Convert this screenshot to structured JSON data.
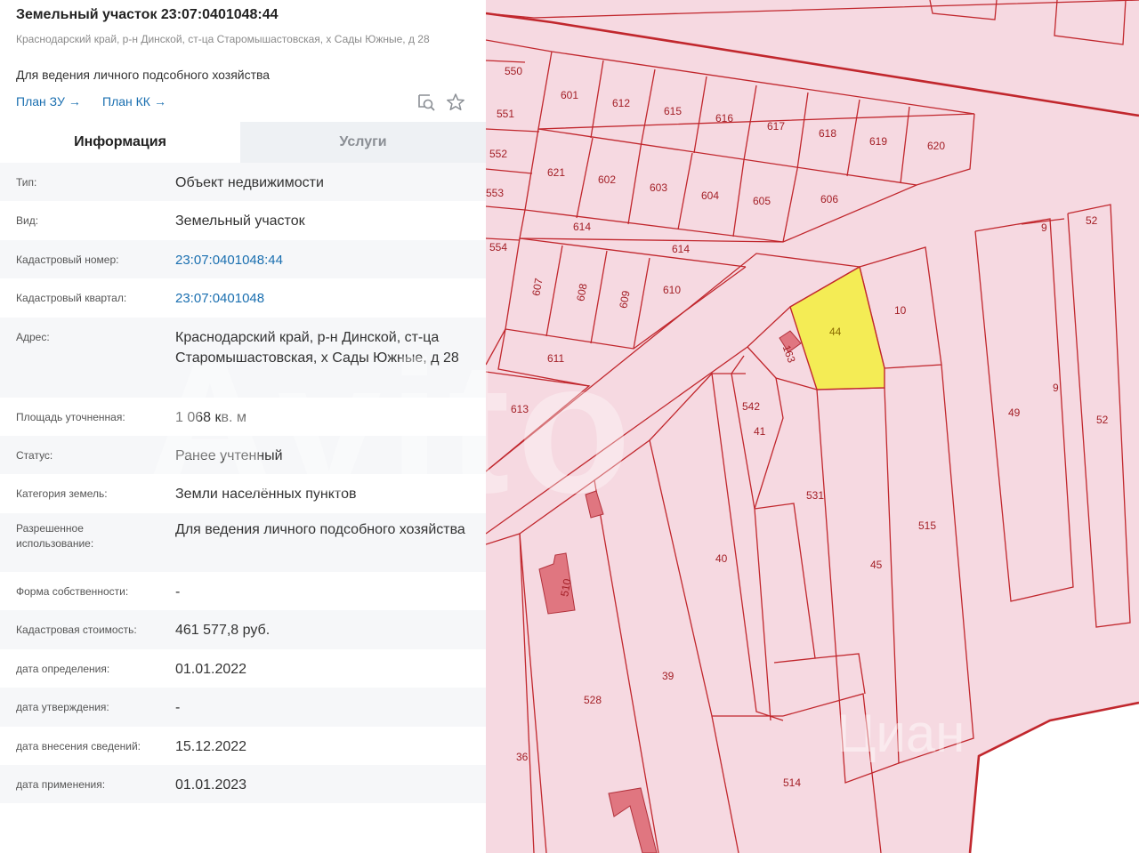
{
  "header": {
    "title": "Земельный участок 23:07:0401048:44",
    "address": "Краснодарский край, р-н Динской, ст-ца Старомышастовская, х Сады Южные, д 28",
    "purpose": "Для ведения личного подсобного хозяйства",
    "links": [
      {
        "label": "План ЗУ"
      },
      {
        "label": "План КК"
      }
    ],
    "arrow": "→"
  },
  "tabs": [
    {
      "label": "Информация",
      "active": true
    },
    {
      "label": "Услуги",
      "active": false
    }
  ],
  "info": [
    {
      "label": "Тип:",
      "value": "Объект недвижимости"
    },
    {
      "label": "Вид:",
      "value": "Земельный участок"
    },
    {
      "label": "Кадастровый номер:",
      "value": "23:07:0401048:44",
      "link": true
    },
    {
      "label": "Кадастровый квартал:",
      "value": "23:07:0401048",
      "link": true
    },
    {
      "label": "Адрес:",
      "value": "Краснодарский край, р-н Динской, ст-ца Старомышастовская, х Сады Южные, д 28"
    },
    {
      "label": "Площадь уточненная:",
      "value": "1 068 кв. м"
    },
    {
      "label": "Статус:",
      "value": "Ранее учтенный"
    },
    {
      "label": "Категория земель:",
      "value": "Земли населённых пунктов"
    },
    {
      "label": "Разрешенное использование:",
      "value": "Для ведения личного подсобного хозяйства"
    },
    {
      "label": "Форма собственности:",
      "value": "-"
    },
    {
      "label": "Кадастровая стоимость:",
      "value": "461 577,8 руб."
    },
    {
      "label": "дата определения:",
      "value": "01.01.2022"
    },
    {
      "label": "дата утверждения:",
      "value": "-"
    },
    {
      "label": "дата внесения сведений:",
      "value": "15.12.2022"
    },
    {
      "label": "дата применения:",
      "value": "01.01.2023"
    }
  ],
  "map": {
    "selected_parcel": "44",
    "parcel_labels": [
      "550",
      "551",
      "552",
      "553",
      "554",
      "601",
      "612",
      "615",
      "616",
      "617",
      "618",
      "619",
      "620",
      "621",
      "602",
      "603",
      "604",
      "605",
      "606",
      "614",
      "614",
      "607",
      "608",
      "609",
      "610",
      "611",
      "613",
      "10",
      "163",
      "542",
      "41",
      "531",
      "515",
      "40",
      "45",
      "49",
      "9",
      "9",
      "52",
      "52",
      "510",
      "528",
      "39",
      "36",
      "514"
    ],
    "colors": {
      "parcel_fill": "#f6d9e1",
      "boundary": "#c1272d",
      "selected_fill": "#f4ec55",
      "building": "#e07680"
    },
    "watermarks": [
      "Avito",
      "Циан"
    ]
  }
}
